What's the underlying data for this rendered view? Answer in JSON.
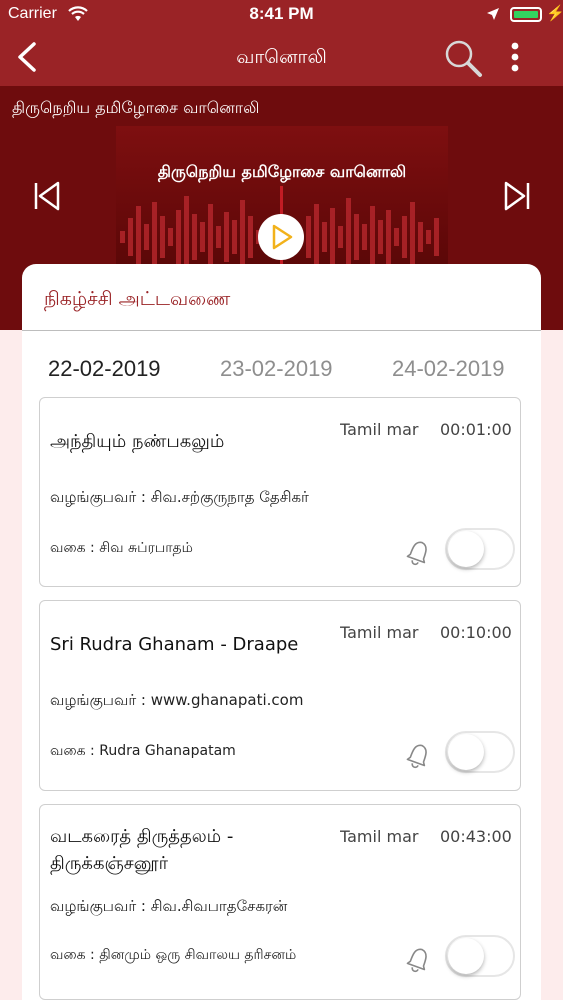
{
  "status_bar": {
    "carrier": "Carrier",
    "time": "8:41 PM"
  },
  "nav": {
    "title": "வானொலி"
  },
  "player": {
    "station_name": "திருநெறிய தமிழோசை வானொலி",
    "artwork_title": "திருநெறிய தமிழோசை வானொலி"
  },
  "schedule": {
    "heading": "நிகழ்ச்சி அட்டவணை",
    "dates": [
      "22-02-2019",
      "23-02-2019",
      "24-02-2019"
    ],
    "selected_date": "22-02-2019",
    "programs": [
      {
        "title": "அந்தியும் நண்பகலும்",
        "language": "Tamil mar",
        "duration": "00:01:00",
        "host": "வழங்குபவர் : சிவ.சற்குருநாத தேசிகர்",
        "genre": "வகை : சிவ சுப்ரபாதம்",
        "reminder_on": false
      },
      {
        "title": "Sri Rudra Ghanam - Draape",
        "language": "Tamil mar",
        "duration": "00:10:00",
        "host": "வழங்குபவர் : www.ghanapati.com",
        "genre": "வகை : Rudra Ghanapatam",
        "reminder_on": false
      },
      {
        "title": "வடகரைத் திருத்தலம் - திருக்கஞ்சனூர்",
        "language": "Tamil mar",
        "duration": "00:43:00",
        "host": "வழங்குபவர் : சிவ.சிவபாதசேகரன்",
        "genre": "வகை : தினமும் ஒரு சிவாலய தரிசனம்",
        "reminder_on": false
      }
    ]
  },
  "colors": {
    "primary": "#9a2326",
    "player_bg": "#6e0c0d",
    "accent": "#f2b21b"
  }
}
